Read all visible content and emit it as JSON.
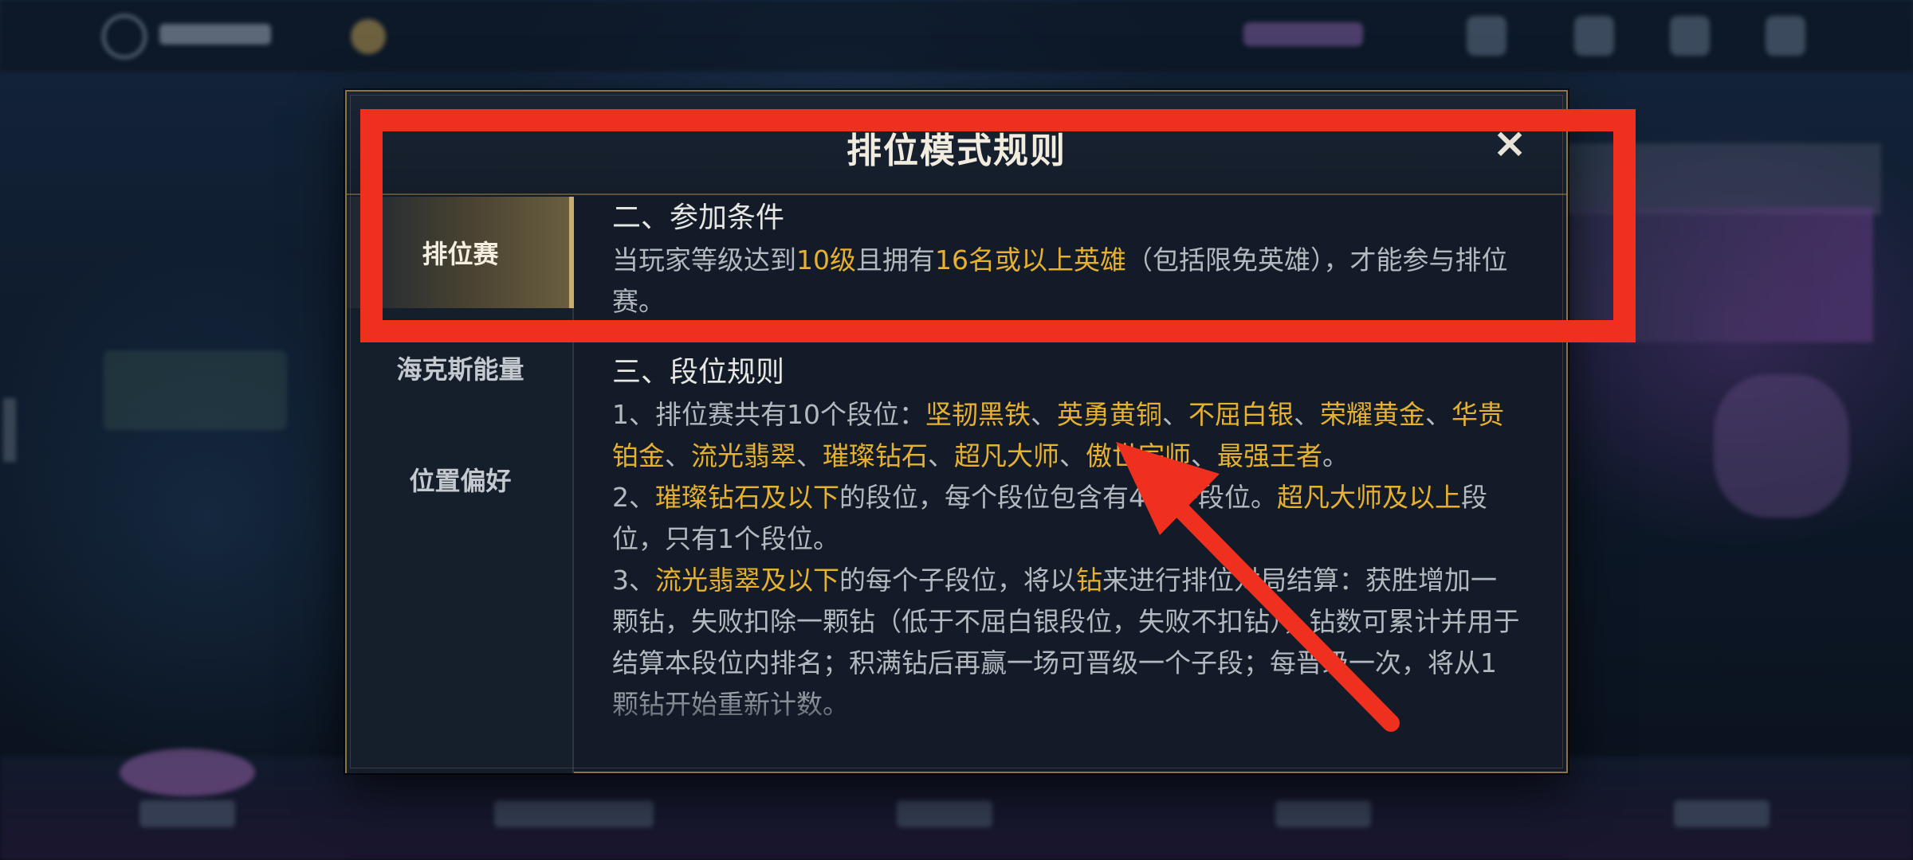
{
  "modal": {
    "title": "排位模式规则",
    "close_label": "×",
    "tabs": [
      {
        "label": "排位赛",
        "active": true
      },
      {
        "label": "海克斯能量",
        "active": false
      },
      {
        "label": "位置偏好",
        "active": false
      }
    ]
  },
  "content": {
    "section2": {
      "title": "二、参加条件",
      "p": [
        "当玩家等级达到",
        "10级",
        "且拥有",
        "16名或以上英雄",
        "（包括限免英雄），才能参与排位赛。"
      ]
    },
    "section3": {
      "title": "三、段位规则",
      "rule1": [
        "1、排位赛共有10个段位：",
        "坚韧黑铁",
        "、",
        "英勇黄铜",
        "、",
        "不屈白银",
        "、",
        "荣耀黄金",
        "、",
        "华贵铂金",
        "、",
        "流光翡翠",
        "、",
        "璀璨钻石",
        "、",
        "超凡大师",
        "、",
        "傲世宗师",
        "、",
        "最强王者",
        "。"
      ],
      "rule2": [
        "2、",
        "璀璨钻石及以下",
        "的段位，每个段位包含有4个子段位。",
        "超凡大师及以上",
        "段位，只有1个段位。"
      ],
      "rule3": [
        "3、",
        "流光翡翠及以下",
        "的每个子段位，将以",
        "钻",
        "来进行排位对局结算：获胜增加一颗钻，失败扣除一颗钻（低于不屈白银段位，失败不扣钻），钻数可累计并用于结算本段位内排名；积满钻后再赢一场可晋级一个子段；每晋级一次，将从1颗钻开始重新计数。"
      ]
    }
  },
  "colors": {
    "highlight": "#e6b030",
    "annotation_red": "#f0301f",
    "gold_border": "#8a7444"
  },
  "icons": {
    "close": "close-icon",
    "arrow": "annotation-arrow-icon"
  }
}
